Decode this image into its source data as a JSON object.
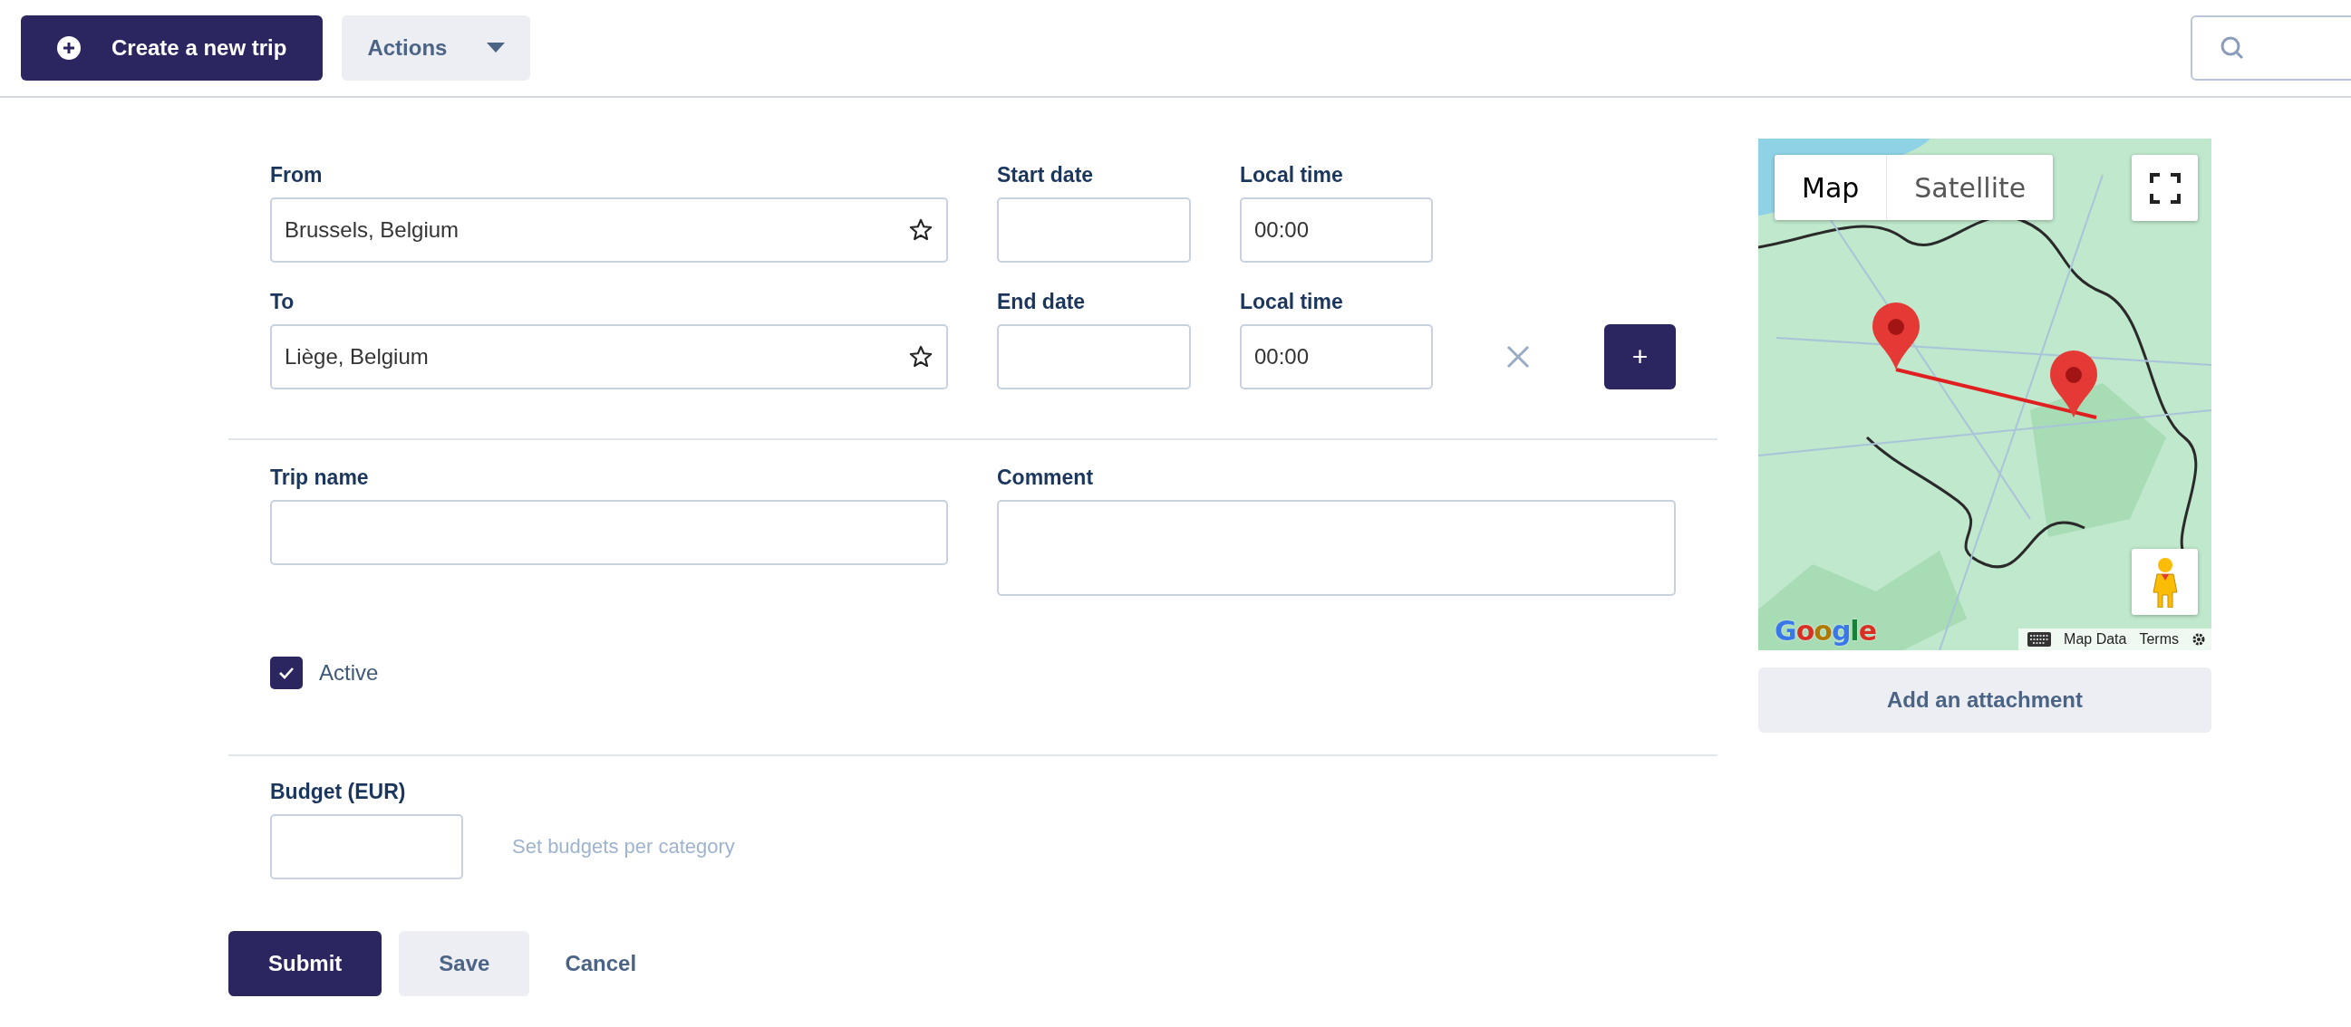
{
  "toolbar": {
    "create_button": "Create a new trip",
    "actions_button": "Actions"
  },
  "legs": [
    {
      "place_label": "From",
      "place": "Brussels, Belgium",
      "date_label": "Start date",
      "time_label": "Local time",
      "time": "00:00",
      "removable": false
    },
    {
      "place_label": "To",
      "place": "Liège, Belgium",
      "date_label": "End date",
      "time_label": "Local time",
      "time": "00:00",
      "removable": true
    }
  ],
  "add_leg_button": "+",
  "trip_name": {
    "label": "Trip name"
  },
  "comment": {
    "label": "Comment"
  },
  "active": {
    "label": "Active",
    "checked": true
  },
  "budget": {
    "label": "Budget (EUR)",
    "link": "Set budgets per category"
  },
  "map": {
    "tabs": [
      {
        "label": "Map",
        "selected": true
      },
      {
        "label": "Satellite",
        "selected": false
      }
    ],
    "logo": "Google",
    "footer": [
      "Map Data",
      "Terms"
    ]
  },
  "attachment_button": "Add an attachment",
  "form_buttons": [
    {
      "label": "Submit",
      "kind": "primary"
    },
    {
      "label": "Save",
      "kind": "secondary"
    },
    {
      "label": "Cancel",
      "kind": "link"
    }
  ]
}
